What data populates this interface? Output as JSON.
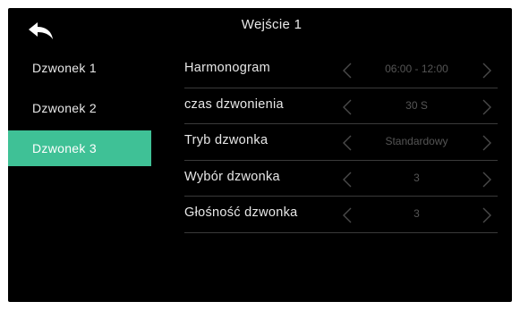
{
  "header": {
    "title": "Wejście 1",
    "back_icon": "back-arrow-icon"
  },
  "sidebar": {
    "items": [
      {
        "label": "Dzwonek 1",
        "active": false
      },
      {
        "label": "Dzwonek 2",
        "active": false
      },
      {
        "label": "Dzwonek 3",
        "active": true
      }
    ],
    "accent_color": "#3fc196"
  },
  "settings": {
    "rows": [
      {
        "label": "Harmonogram",
        "value": "06:00 - 12:00"
      },
      {
        "label": "czas dzwonienia",
        "value": "30 S"
      },
      {
        "label": "Tryb dzwonka",
        "value": "Standardowy"
      },
      {
        "label": "Wybór dzwonka",
        "value": "3"
      },
      {
        "label": "Głośność dzwonka",
        "value": "3"
      }
    ]
  }
}
